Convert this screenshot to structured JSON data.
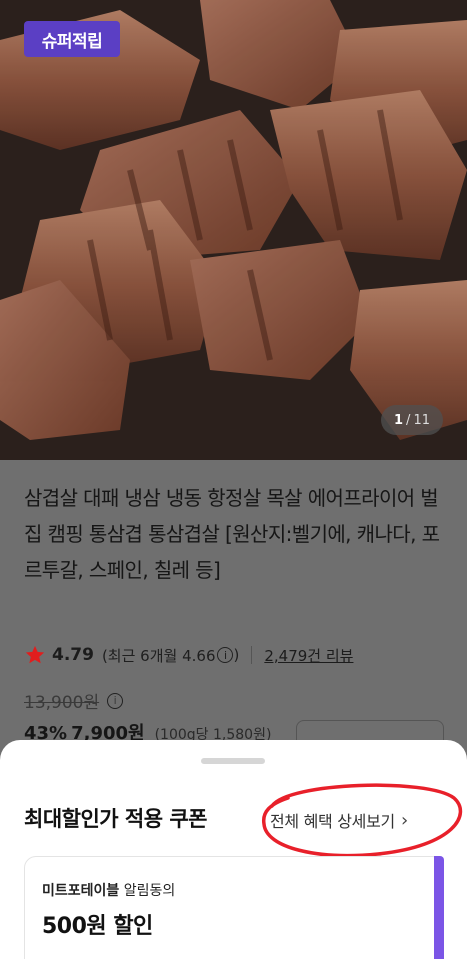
{
  "hero": {
    "badge": "슈퍼적립",
    "counter_current": "1",
    "counter_sep": "/",
    "counter_total": "11"
  },
  "product": {
    "title": "삼겹살 대패 냉삼 냉동 항정살 목살 에어프라이어 벌집 캠핑 통삼겹 통삼겹살 [원산지:벨기에, 캐나다, 포르투갈, 스페인, 칠레 등]",
    "rating": "4.79",
    "recent_label": "(최근 6개월 4.66",
    "recent_close": ")",
    "reviews": "2,479건 리뷰",
    "original_price": "13,900원",
    "discount_rate": "43%",
    "sale_price": "7,900원",
    "unit_price": "(100g당 1,580원)"
  },
  "sheet": {
    "title": "최대할인가 적용 쿠폰",
    "detail_link": "전체 혜택 상세보기",
    "chevron": "›",
    "coupon": {
      "brand": "미트포테이블",
      "brand_suffix": " 알림동의",
      "amount": "500원 할인"
    }
  },
  "colors": {
    "badge": "#5b3fc4",
    "star": "#e11d1d",
    "coupon_accent": "#7b55e6",
    "annotation": "#e8202a"
  },
  "icons": {
    "star": "star-icon",
    "info": "info-icon",
    "chevron": "chevron-right-icon"
  }
}
